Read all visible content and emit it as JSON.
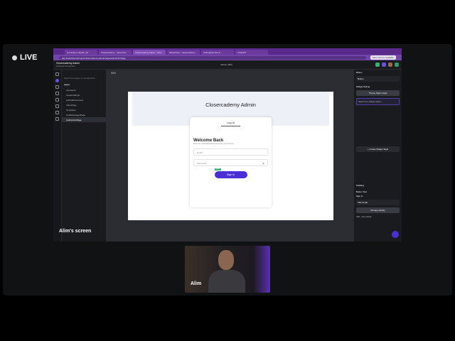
{
  "live_label": "LIVE",
  "screen_label": "Alim's screen",
  "presenter_name": "Alim",
  "browser": {
    "tabs": [
      "Generate in Studio | AI",
      "Closercademy - Cloud Fire",
      "Closercademy Admin - Flutt",
      "FlutterFlow - Closercademy",
      "suliun@thumbe.io",
      "ChatGPT"
    ],
    "active_tab": 2,
    "url": "app.flutterflow.io/project/closercademy-admin/page/authAdminPage",
    "chrome_button": "New Chrome available"
  },
  "app": {
    "project_name": "Closercademy Admin",
    "project_sub": "Firebase Production",
    "device_label": "Mobile (390)",
    "zoom": "90%",
    "search_placeholder": "Search for pages or components...",
    "folder": "pages",
    "pages": [
      "userHome",
      "createCallings",
      "editCallsOverview",
      "VideoPage",
      "Templates",
      "ChatMessagesPage",
      "AuthAdminPage"
    ],
    "selected_page": 6
  },
  "preview": {
    "title": "Closercademy Admin",
    "tab": "Log In",
    "welcome": "Welcome Back",
    "subtitle": "Enter the credentials below to access your account.",
    "email_placeholder": "Email",
    "password_placeholder": "Password",
    "signin_label": "Sign In",
    "badge": "Button"
  },
  "properties": {
    "widget": "Button",
    "name": "Button",
    "widget_styling": "Widget Styling",
    "theme_style": "Theme Style Unset",
    "style_search": "Search for widget styles...",
    "create_style": "+ Create Widget Style",
    "text_section": "Button Text",
    "text_value": "Sign In",
    "font_style": "Title Small",
    "font_family": "Primary Family",
    "font_weight": "400 - Semi Bold",
    "padding": "Padding"
  }
}
